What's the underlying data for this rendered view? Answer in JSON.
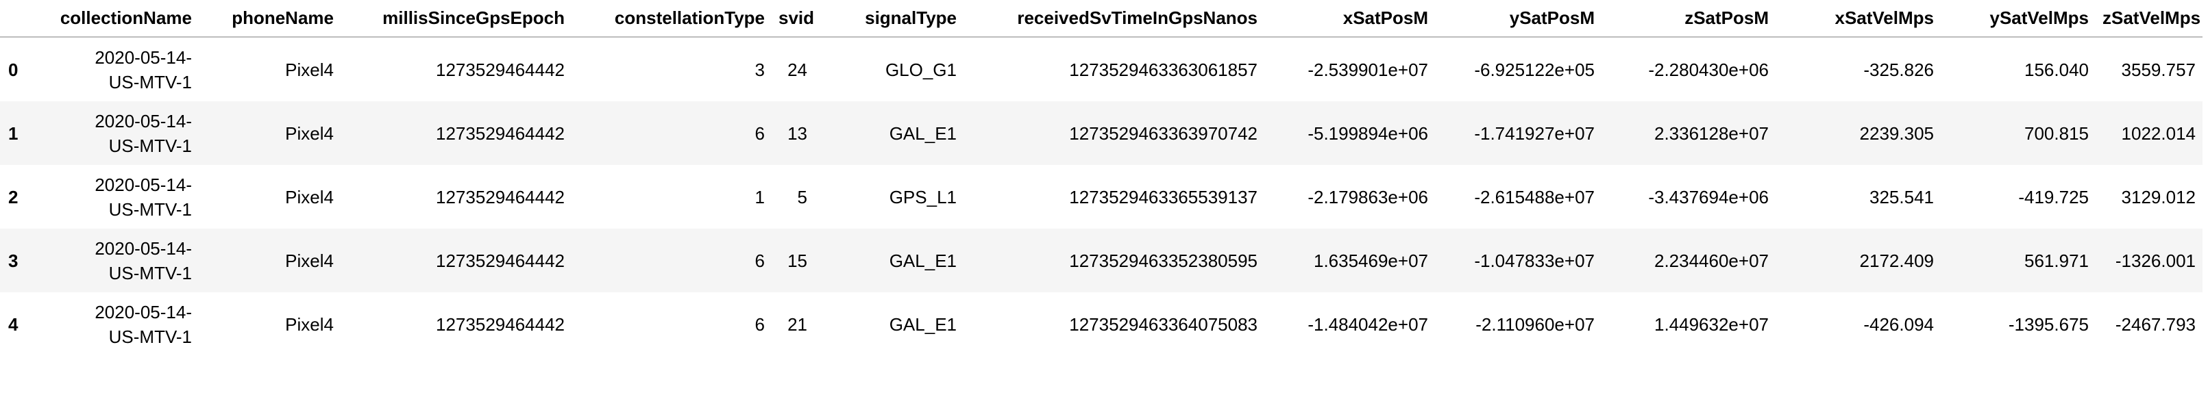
{
  "table": {
    "columns": [
      "",
      "collectionName",
      "phoneName",
      "millisSinceGpsEpoch",
      "constellationType",
      "svid",
      "signalType",
      "receivedSvTimeInGpsNanos",
      "xSatPosM",
      "ySatPosM",
      "zSatPosM",
      "xSatVelMps",
      "ySatVelMps",
      "zSatVelMps"
    ],
    "rows": [
      [
        "0",
        "2020-05-14-US-MTV-1",
        "Pixel4",
        "1273529464442",
        "3",
        "24",
        "GLO_G1",
        "1273529463363061857",
        "-2.539901e+07",
        "-6.925122e+05",
        "-2.280430e+06",
        "-325.826",
        "156.040",
        "3559.757"
      ],
      [
        "1",
        "2020-05-14-US-MTV-1",
        "Pixel4",
        "1273529464442",
        "6",
        "13",
        "GAL_E1",
        "1273529463363970742",
        "-5.199894e+06",
        "-1.741927e+07",
        "2.336128e+07",
        "2239.305",
        "700.815",
        "1022.014"
      ],
      [
        "2",
        "2020-05-14-US-MTV-1",
        "Pixel4",
        "1273529464442",
        "1",
        "5",
        "GPS_L1",
        "1273529463365539137",
        "-2.179863e+06",
        "-2.615488e+07",
        "-3.437694e+06",
        "325.541",
        "-419.725",
        "3129.012"
      ],
      [
        "3",
        "2020-05-14-US-MTV-1",
        "Pixel4",
        "1273529464442",
        "6",
        "15",
        "GAL_E1",
        "1273529463352380595",
        "1.635469e+07",
        "-1.047833e+07",
        "2.234460e+07",
        "2172.409",
        "561.971",
        "-1326.001"
      ],
      [
        "4",
        "2020-05-14-US-MTV-1",
        "Pixel4",
        "1273529464442",
        "6",
        "21",
        "GAL_E1",
        "1273529463364075083",
        "-1.484042e+07",
        "-2.110960e+07",
        "1.449632e+07",
        "-426.094",
        "-1395.675",
        "-2467.793"
      ]
    ]
  }
}
